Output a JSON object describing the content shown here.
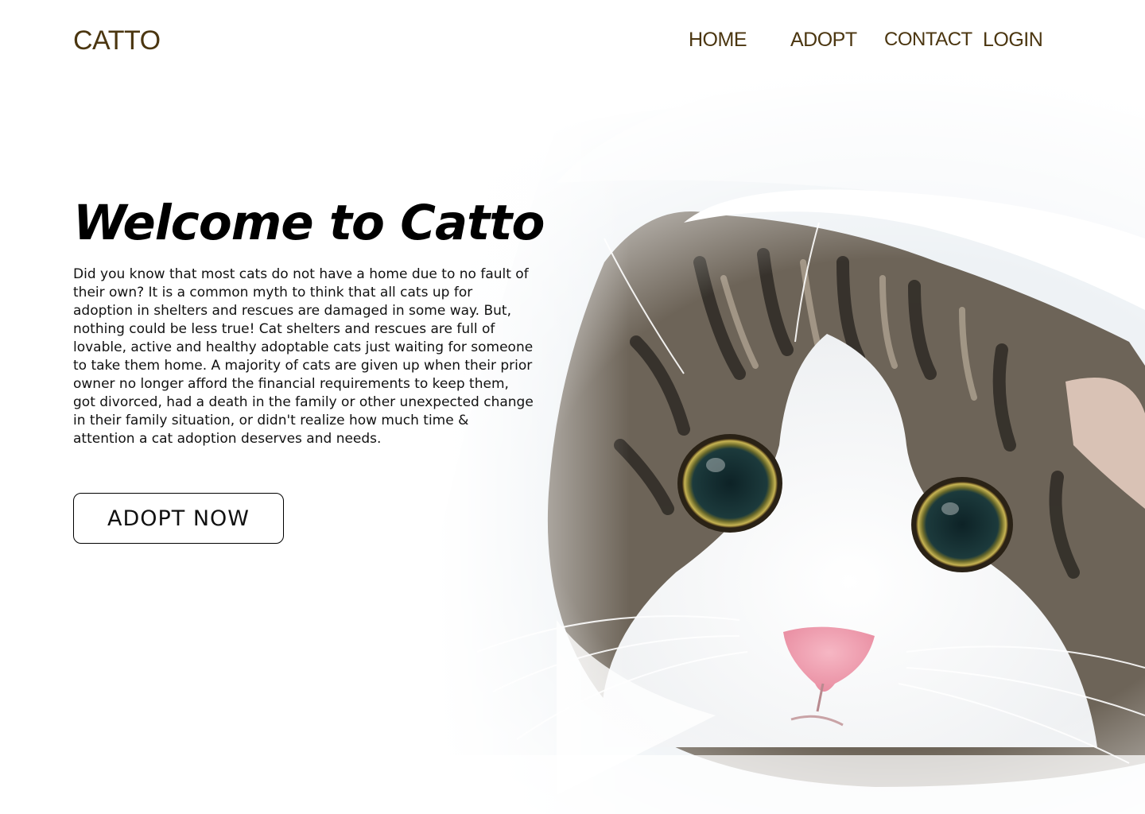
{
  "brand": {
    "name": "CATTO",
    "color": "#4b3610"
  },
  "nav": {
    "items": [
      {
        "label": "HOME"
      },
      {
        "label": "ADOPT"
      },
      {
        "label": "CONTACT"
      },
      {
        "label": "LOGIN"
      }
    ]
  },
  "hero": {
    "headline": "Welcome to Catto",
    "body": "Did you know that most cats do not have a home due to no fault of their own? It is a common myth to think that all cats up for adoption in shelters and rescues are damaged in some way. But, nothing could be less true! Cat shelters and rescues are full of lovable, active and healthy adoptable cats just waiting for someone to take them home. A majority of cats are given up when their prior owner no longer afford the financial requirements to keep them, got divorced, had a death in the family or other unexpected change in their family situation, or didn't realize how much time & attention a cat adoption deserves and needs.",
    "cta_label": "ADOPT NOW",
    "image_icon": "tabby-kitten-under-blanket-photo"
  }
}
